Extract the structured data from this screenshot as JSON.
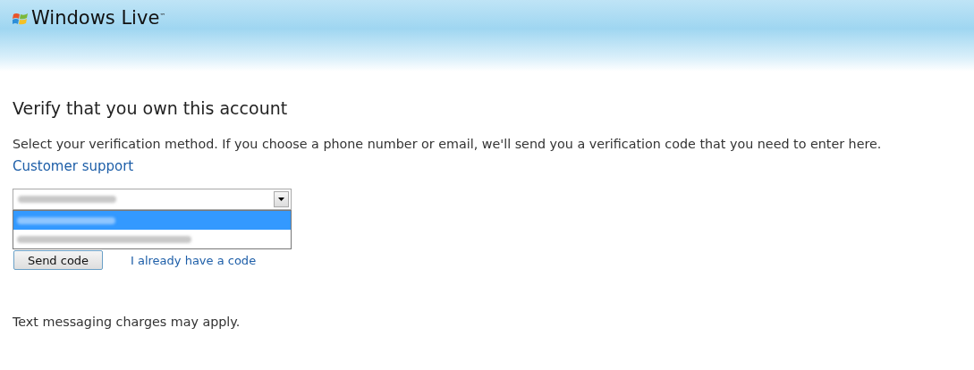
{
  "header": {
    "brand": "Windows Live",
    "trademark": "™"
  },
  "heading": "Verify that you own this account",
  "instructions": "Select your verification method. If you choose a phone number or email, we'll send you a verification code that you need to enter here.",
  "support_link": "Customer support",
  "method_select": {
    "expanded": true,
    "options": [
      {
        "selected": true
      },
      {
        "selected": false
      }
    ]
  },
  "send_button": "Send code",
  "have_code_link": "I already have a code",
  "note": "Text messaging charges may apply."
}
